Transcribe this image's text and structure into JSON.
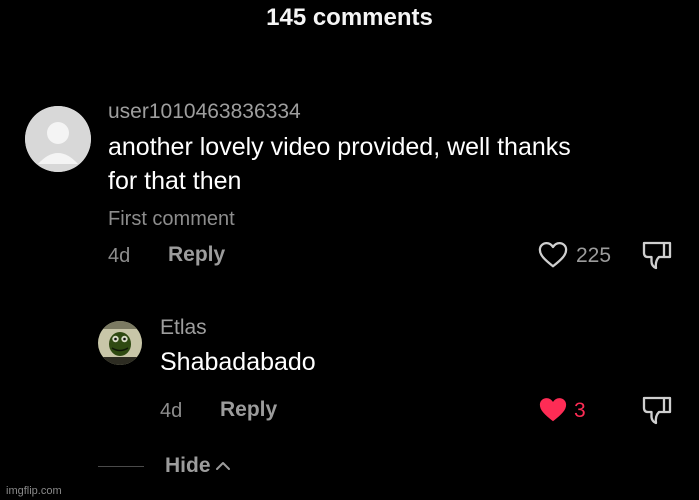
{
  "header": {
    "title": "145 comments"
  },
  "comments": [
    {
      "username": "user1010463836334",
      "text_line1": "another lovely video provided, well thanks",
      "text_line2": "for that then",
      "badge": "First comment",
      "time": "4d",
      "reply_label": "Reply",
      "likes": "225",
      "liked": false
    }
  ],
  "replies": [
    {
      "username": "Etlas",
      "text": "Shabadabado",
      "time": "4d",
      "reply_label": "Reply",
      "likes": "3",
      "liked": true
    }
  ],
  "thread": {
    "hide_label": "Hide"
  },
  "watermark": "imgflip.com",
  "colors": {
    "background": "#000000",
    "like_active": "#fe2c55",
    "muted_text": "#8d8d8d"
  },
  "icons": [
    "default-avatar-icon",
    "heart-icon",
    "dislike-icon",
    "chevron-up-icon"
  ]
}
